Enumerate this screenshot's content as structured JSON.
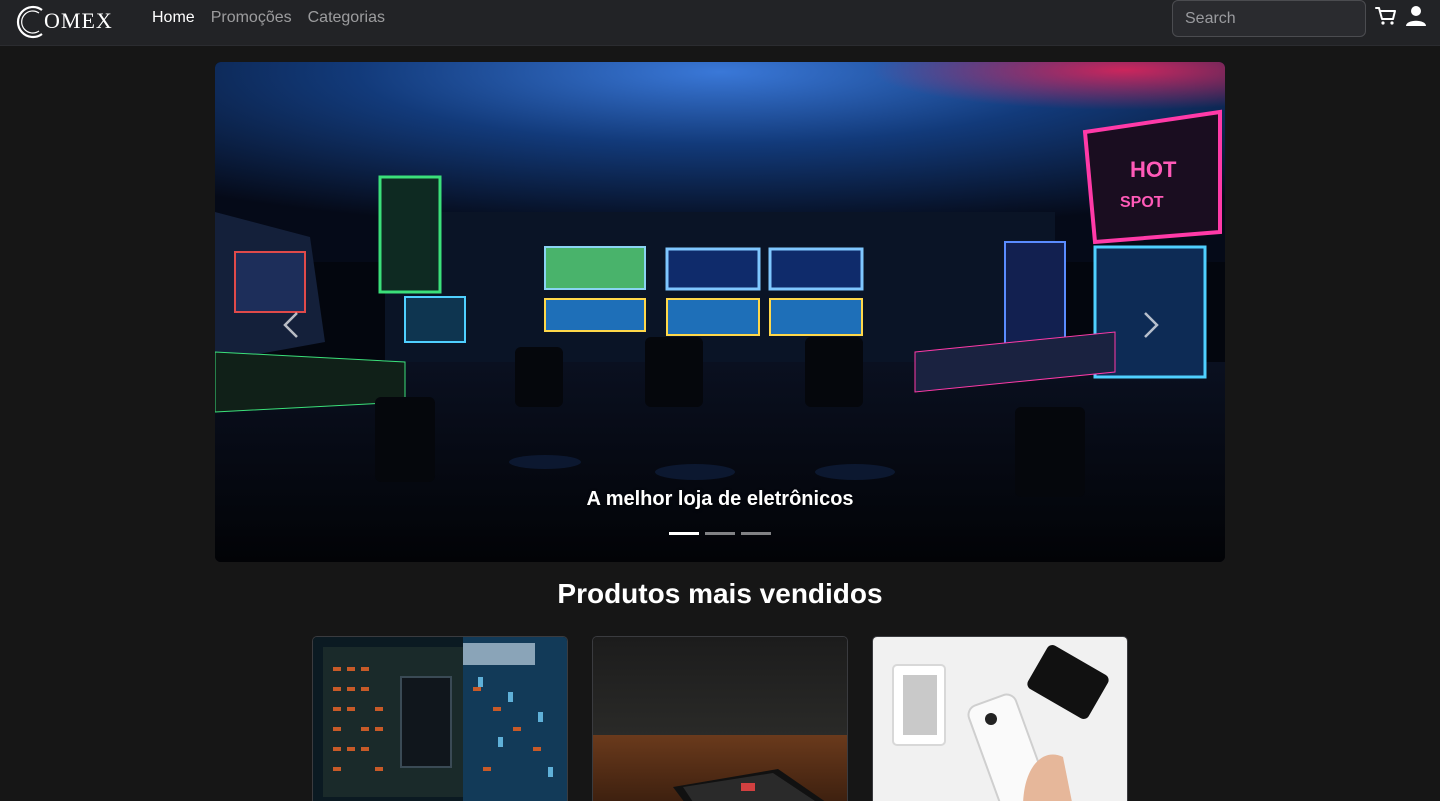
{
  "brand": {
    "name": "OMEX",
    "logo_letter": "C"
  },
  "nav": {
    "links": [
      {
        "label": "Home",
        "active": true
      },
      {
        "label": "Promoções",
        "active": false
      },
      {
        "label": "Categorias",
        "active": false
      }
    ],
    "search": {
      "placeholder": "Search",
      "value": ""
    },
    "icons": [
      "cart-icon",
      "user-icon"
    ]
  },
  "carousel": {
    "caption": "A melhor loja de eletrônicos",
    "slide_count": 3,
    "active_slide": 0,
    "controls": [
      "chevron-left-icon",
      "chevron-right-icon"
    ]
  },
  "section": {
    "title": "Produtos mais vendidos"
  },
  "products": [
    {
      "image": "circuit-board"
    },
    {
      "image": "smartphone-on-table"
    },
    {
      "image": "hand-holding-iphone"
    }
  ],
  "colors": {
    "page_bg": "#161616",
    "navbar_bg": "#222326",
    "text": "#ffffff",
    "muted_link": "#8d8e91"
  }
}
